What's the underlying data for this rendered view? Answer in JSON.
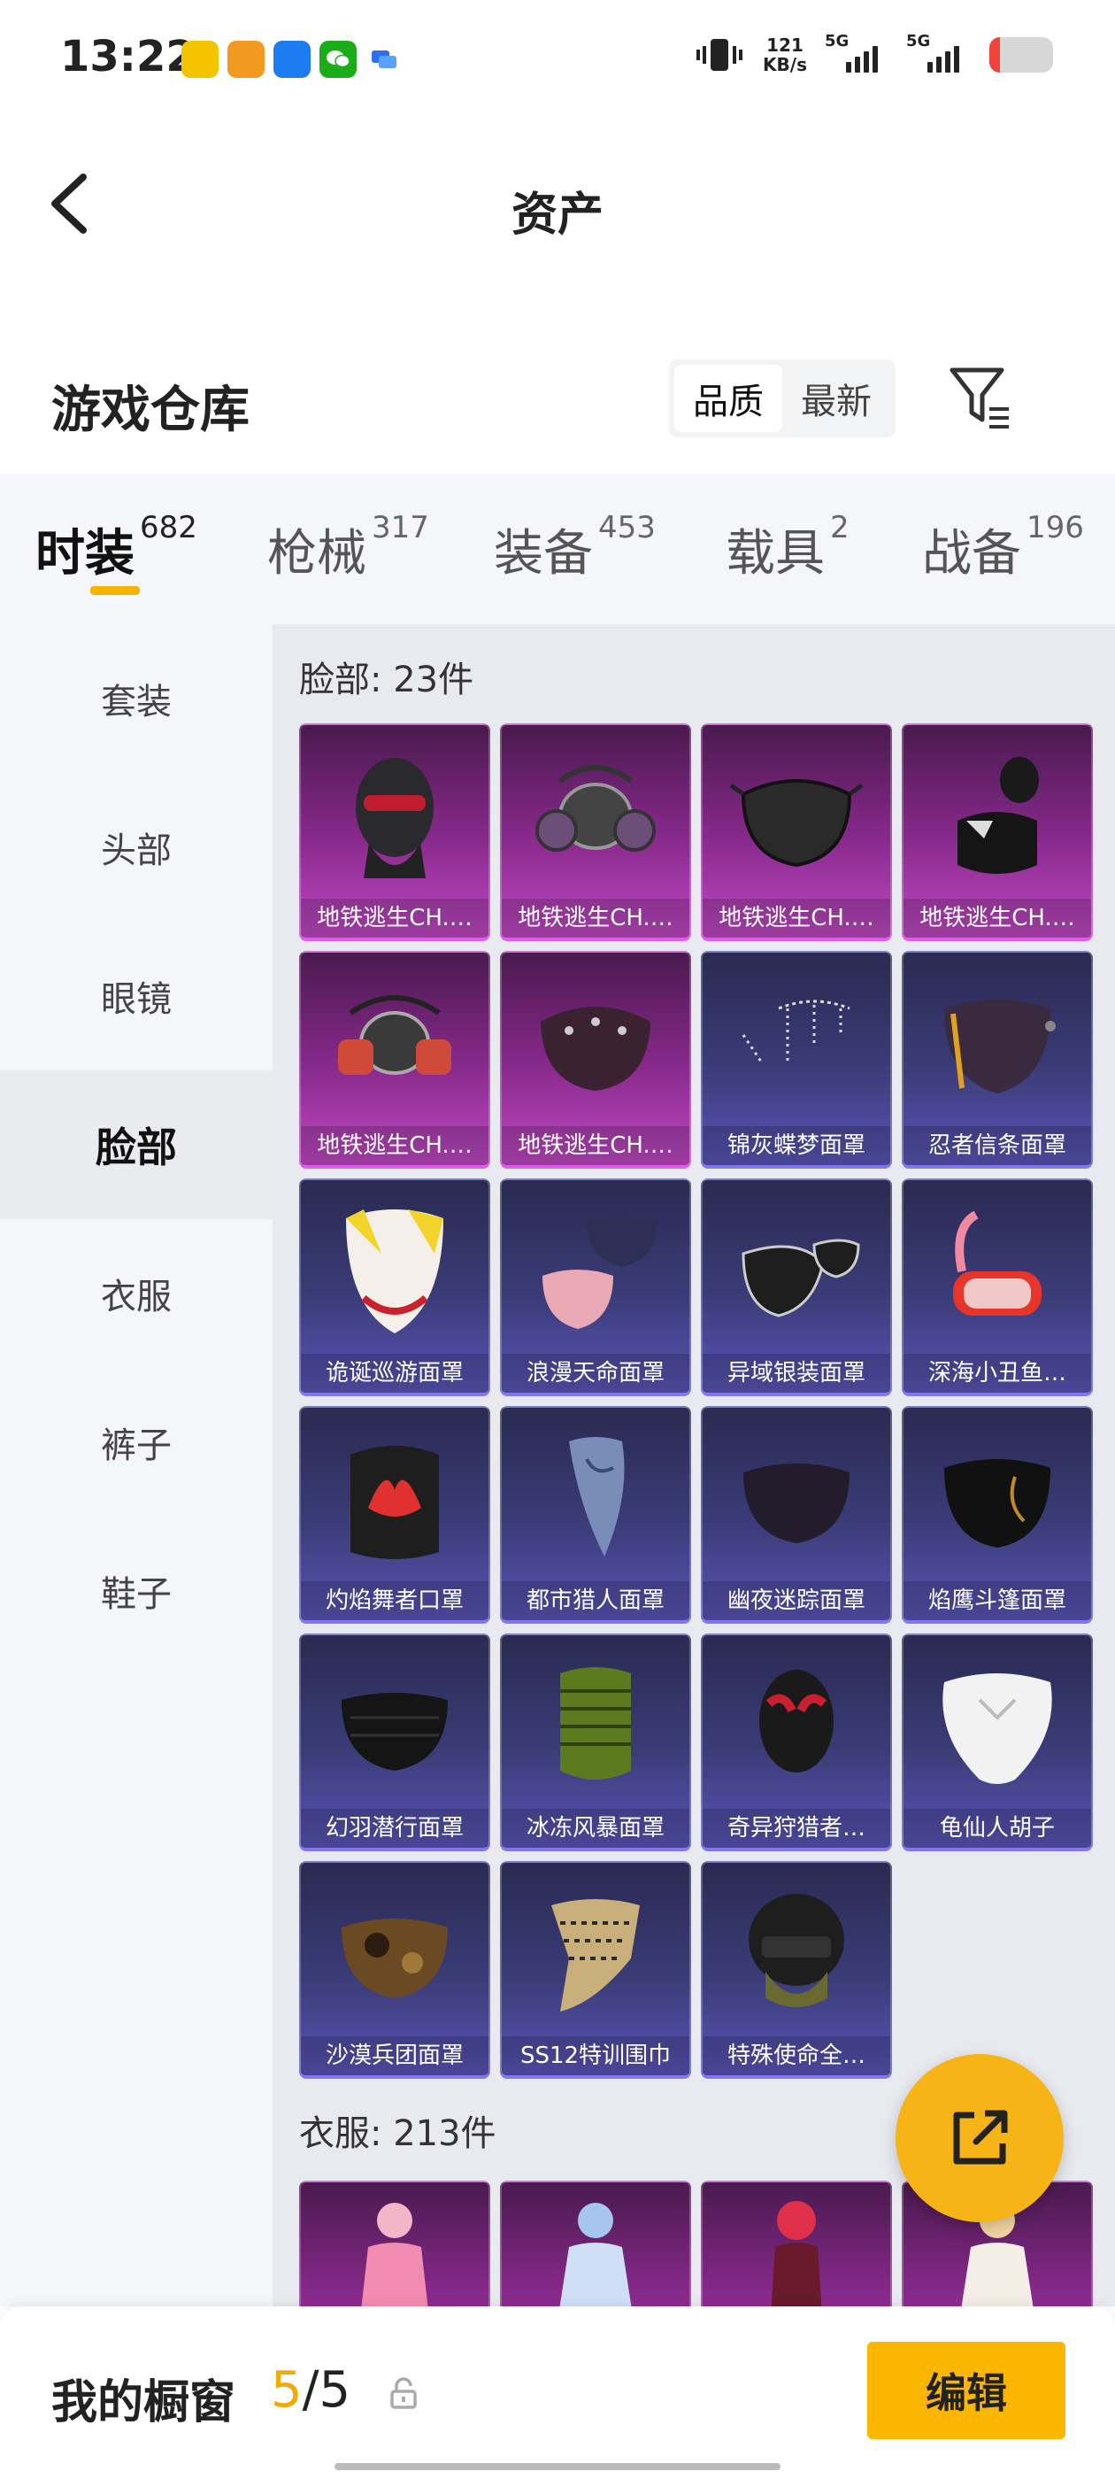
{
  "status": {
    "time": "13:22",
    "net_speed_value": "121",
    "net_speed_unit": "KB/s",
    "sim1": "5G",
    "sim2": "5G"
  },
  "nav": {
    "title": "资产"
  },
  "warehouse": {
    "title": "游戏仓库",
    "sort_options": [
      "品质",
      "最新"
    ],
    "active_sort": "品质"
  },
  "tabs": [
    {
      "label": "时装",
      "count": "682"
    },
    {
      "label": "枪械",
      "count": "317"
    },
    {
      "label": "装备",
      "count": "453"
    },
    {
      "label": "载具",
      "count": "2"
    },
    {
      "label": "战备",
      "count": "196"
    }
  ],
  "sidebar": {
    "items": [
      "套装",
      "头部",
      "眼镜",
      "脸部",
      "衣服",
      "裤子",
      "鞋子"
    ],
    "active": "脸部"
  },
  "sections": [
    {
      "label": "脸部: 23件",
      "items": [
        {
          "name": "地铁逃生CH.…",
          "rarity": "purple",
          "icon": "balaclava-mask-icon"
        },
        {
          "name": "地铁逃生CH.…",
          "rarity": "purple",
          "icon": "gas-mask-icon"
        },
        {
          "name": "地铁逃生CH.…",
          "rarity": "purple",
          "icon": "black-face-mask-icon"
        },
        {
          "name": "地铁逃生CH.…",
          "rarity": "purple",
          "icon": "neck-gaiter-icon"
        },
        {
          "name": "地铁逃生CH.…",
          "rarity": "purple",
          "icon": "respirator-icon"
        },
        {
          "name": "地铁逃生CH.…",
          "rarity": "purple",
          "icon": "studded-mask-icon"
        },
        {
          "name": "锦灰蝶梦面罩",
          "rarity": "blue",
          "icon": "chain-mask-icon"
        },
        {
          "name": "忍者信条面罩",
          "rarity": "blue",
          "icon": "ninja-mask-icon"
        },
        {
          "name": "诡诞巡游面罩",
          "rarity": "blue",
          "icon": "clown-mask-icon"
        },
        {
          "name": "浪漫天命面罩",
          "rarity": "blue",
          "icon": "cloth-masks-icon"
        },
        {
          "name": "异域银装面罩",
          "rarity": "blue",
          "icon": "silver-mask-icon"
        },
        {
          "name": "深海小丑鱼…",
          "rarity": "blue",
          "icon": "snorkel-mask-icon"
        },
        {
          "name": "灼焰舞者口罩",
          "rarity": "blue",
          "icon": "flame-mask-icon"
        },
        {
          "name": "都市猎人面罩",
          "rarity": "blue",
          "icon": "bandana-icon"
        },
        {
          "name": "幽夜迷踪面罩",
          "rarity": "blue",
          "icon": "dark-face-mask-icon"
        },
        {
          "name": "焰鹰斗篷面罩",
          "rarity": "blue",
          "icon": "gold-pattern-mask-icon"
        },
        {
          "name": "幻羽潜行面罩",
          "rarity": "blue",
          "icon": "black-surgical-mask-icon"
        },
        {
          "name": "冰冻风暴面罩",
          "rarity": "blue",
          "icon": "green-gaiter-icon"
        },
        {
          "name": "奇异狩猎者…",
          "rarity": "blue",
          "icon": "hunter-mask-icon"
        },
        {
          "name": "龟仙人胡子",
          "rarity": "blue",
          "icon": "white-beard-icon"
        },
        {
          "name": "沙漠兵团面罩",
          "rarity": "blue",
          "icon": "camo-mask-icon"
        },
        {
          "name": "SS12特训围巾",
          "rarity": "blue",
          "icon": "shemagh-scarf-icon"
        },
        {
          "name": "特殊使命全…",
          "rarity": "blue",
          "icon": "tactical-helmet-icon"
        }
      ]
    },
    {
      "label": "衣服: 213件",
      "items": [
        {
          "name": "",
          "rarity": "purple",
          "icon": "pink-dress-figure-icon"
        },
        {
          "name": "",
          "rarity": "purple",
          "icon": "blue-dress-figure-icon"
        },
        {
          "name": "",
          "rarity": "purple",
          "icon": "red-hair-figure-icon"
        },
        {
          "name": "",
          "rarity": "purple",
          "icon": "white-dress-figure-icon"
        }
      ]
    }
  ],
  "showcase": {
    "label": "我的橱窗",
    "current": "5",
    "sep": "/",
    "total": "5"
  },
  "edit_label": "编辑",
  "colors": {
    "accent": "#f5b400",
    "purple_rarity": "#c04ac4",
    "blue_rarity": "#5a55b8"
  }
}
